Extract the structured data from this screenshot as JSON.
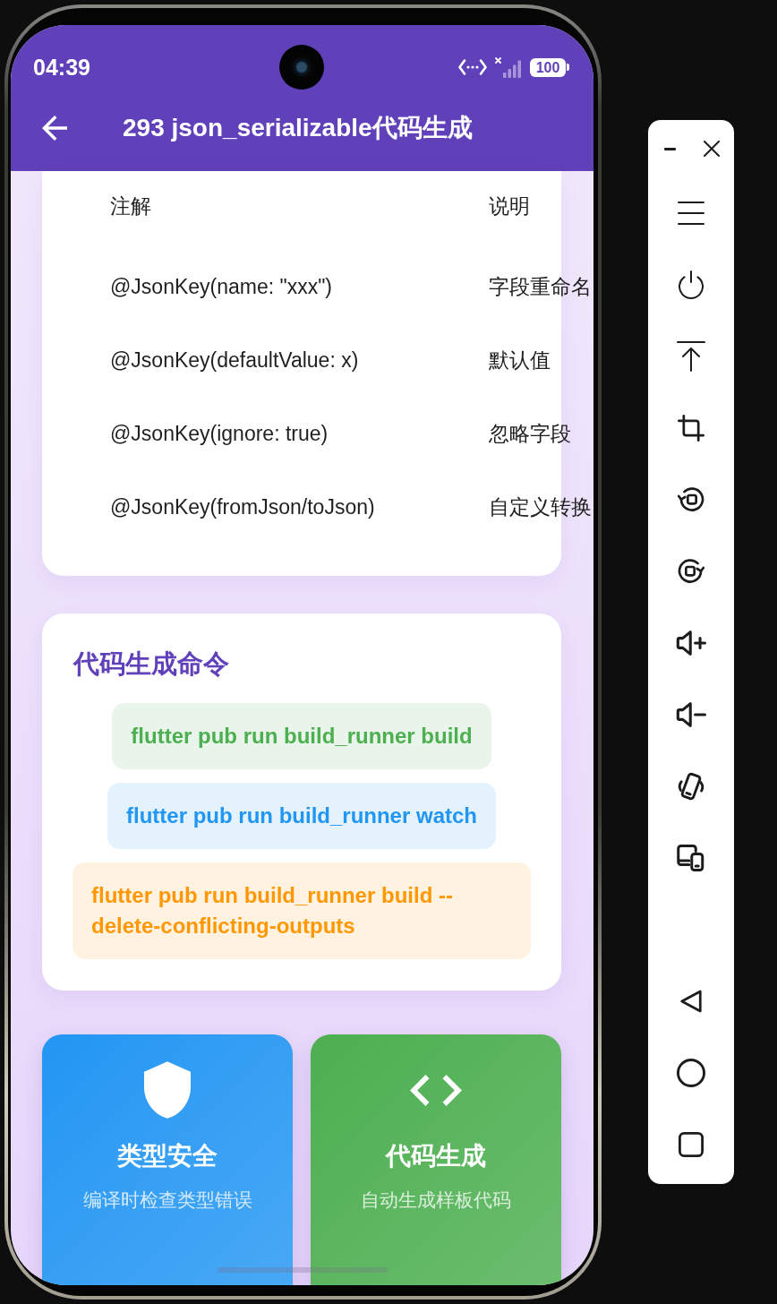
{
  "status_bar": {
    "time": "04:39",
    "battery": "100"
  },
  "app_bar": {
    "title": "293 json_serializable代码生成"
  },
  "annotation_table": {
    "columns": [
      "注解",
      "说明"
    ],
    "rows": [
      [
        "@JsonKey(name: \"xxx\")",
        "字段重命名"
      ],
      [
        "@JsonKey(defaultValue: x)",
        "默认值"
      ],
      [
        "@JsonKey(ignore: true)",
        "忽略字段"
      ],
      [
        "@JsonKey(fromJson/toJson)",
        "自定义转换"
      ]
    ]
  },
  "commands_card": {
    "title": "代码生成命令",
    "commands": [
      {
        "text": "flutter pub run build_runner build",
        "color": "#4caf50"
      },
      {
        "text": "flutter pub run build_runner watch",
        "color": "#2196f3"
      },
      {
        "text": "flutter pub run build_runner build --delete-conflicting-outputs",
        "color": "#ff9800"
      }
    ]
  },
  "feature_cards": [
    {
      "title": "类型安全",
      "subtitle": "编译时检查类型错误",
      "color": "#2196f3"
    },
    {
      "title": "代码生成",
      "subtitle": "自动生成样板代码",
      "color": "#4caf50"
    }
  ]
}
